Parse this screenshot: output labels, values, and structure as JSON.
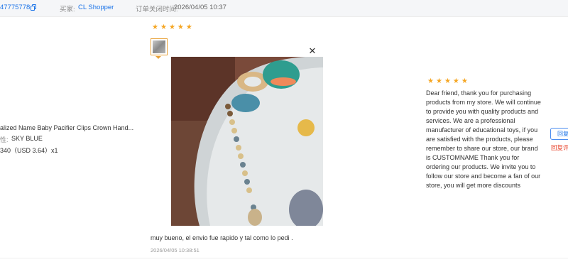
{
  "header": {
    "order_no": "47775778",
    "buyer_label": "买家:",
    "buyer_name": "CL Shopper",
    "closed_label": "订单关闭时间:",
    "closed_time": "2026/04/05 10:37"
  },
  "product": {
    "name": "alized Name Baby Pacifier Clips Crown Hand...",
    "sku_label": "性:",
    "sku_value": "SKY BLUE",
    "price": "340（USD  3.64）x1"
  },
  "review": {
    "rating": 5,
    "text": "muy bueno, el envio fue rapido y tal como lo pedi .",
    "time": "2026/04/05 10:38:51"
  },
  "seller_reply": {
    "rating": 5,
    "text": "Dear friend, thank you for purchasing products from my store. We will continue to provide you with quality products and services. We are a professional manufacturer of educational toys, if you are satisfied with the products, please remember to share our store, our brand is CUSTOMNAME Thank you for ordering our products. We invite you to follow our store and become a fan of our store, you will get more discounts"
  },
  "actions": {
    "reply_button": "回复",
    "reply_link": "回复评"
  },
  "icons": {
    "copy": "copy-icon",
    "close": "close-icon",
    "star": "star-icon"
  },
  "colors": {
    "link_blue": "#1a73e8",
    "star_orange": "#f5a623",
    "reply_red": "#e8422a"
  }
}
